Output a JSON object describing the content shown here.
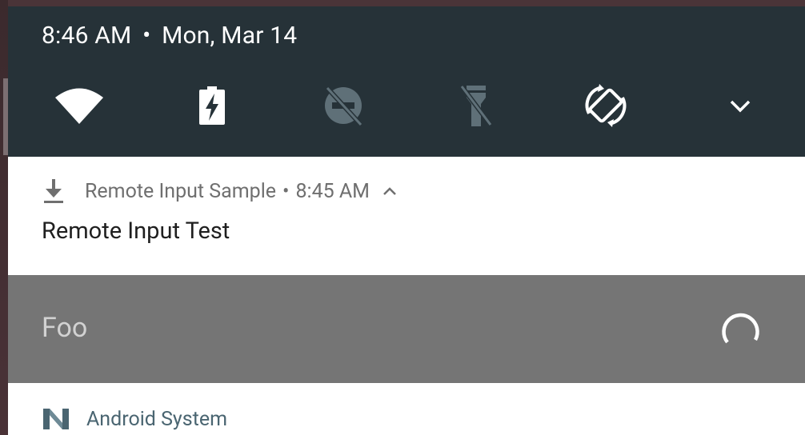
{
  "status": {
    "time": "8:46 AM",
    "separator": "•",
    "date": "Mon, Mar 14"
  },
  "quick_settings": {
    "tiles": [
      {
        "icon": "wifi-icon",
        "state": "on"
      },
      {
        "icon": "battery-charging-icon",
        "state": "on"
      },
      {
        "icon": "do-not-disturb-off-icon",
        "state": "off"
      },
      {
        "icon": "flashlight-off-icon",
        "state": "off"
      },
      {
        "icon": "auto-rotate-icon",
        "state": "on"
      }
    ],
    "expand_icon": "chevron-down-icon"
  },
  "notification": {
    "app_icon": "download-icon",
    "app_name": "Remote Input Sample",
    "separator": "•",
    "time": "8:45 AM",
    "expand_icon": "chevron-up-icon",
    "title": "Remote Input Test"
  },
  "remote_input": {
    "text": "Foo",
    "status_icon": "progress-spinner-icon"
  },
  "notification2": {
    "app_icon": "android-n-icon",
    "app_name": "Android System"
  },
  "colors": {
    "qs_background": "#263238",
    "notification_background": "#ffffff",
    "reply_background": "#757575",
    "header_text": "#6f6f6f",
    "system_accent": "#4a6571"
  }
}
